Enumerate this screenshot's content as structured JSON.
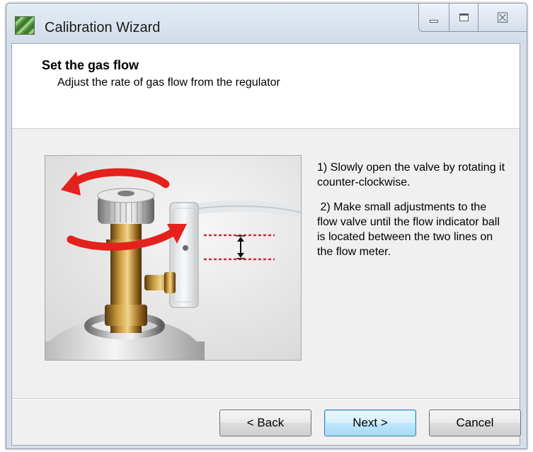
{
  "window": {
    "title": "Calibration Wizard",
    "icons": {
      "app": "wizard-app-icon",
      "minimize": "minimize-icon",
      "maximize": "maximize-icon",
      "close": "close-icon"
    },
    "close_glyph": "☒"
  },
  "header": {
    "title": "Set the gas flow",
    "subtitle": "Adjust the rate of gas flow from the regulator"
  },
  "instructions": {
    "step1": "1) Slowly open the valve by rotating it counter-clockwise.",
    "step2": " 2) Make small adjustments to the flow valve until the flow indicator ball is located between the two lines on the flow meter."
  },
  "image": {
    "subject": "gas-regulator-valve-photo",
    "arrow_color": "#e4211c",
    "line_color": "#d9262a"
  },
  "buttons": {
    "back": "< Back",
    "next": "Next >",
    "cancel": "Cancel"
  },
  "colors": {
    "titlebar": "#d6dfe9",
    "content_bg": "#f0f0f0",
    "header_bg": "#ffffff",
    "default_button_border": "#3c7fb1"
  }
}
